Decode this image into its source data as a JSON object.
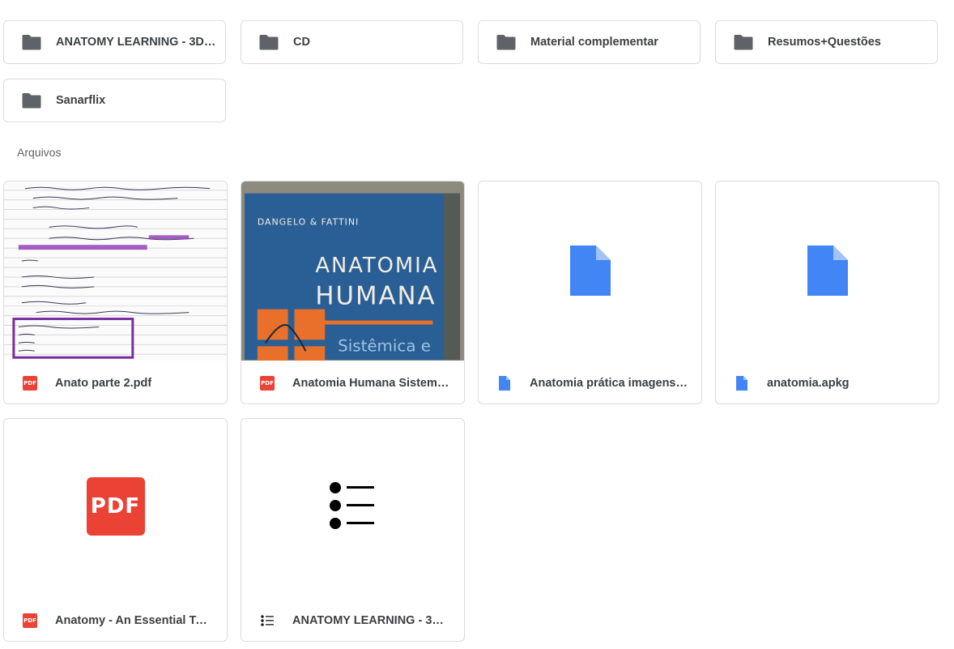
{
  "folders": [
    {
      "name": "ANATOMY LEARNING - 3D A..."
    },
    {
      "name": "CD"
    },
    {
      "name": "Material complementar"
    },
    {
      "name": "Resumos+Questões"
    },
    {
      "name": "Sanarflix"
    }
  ],
  "files_section": {
    "label": "Arquivos"
  },
  "files": [
    {
      "name": "Anato parte 2.pdf",
      "type_icon": "pdf-icon"
    },
    {
      "name": "Anatomia Humana Sistemic...",
      "type_icon": "pdf-icon"
    },
    {
      "name": "Anatomia prática imagens.a...",
      "type_icon": "file-icon"
    },
    {
      "name": "anatomia.apkg",
      "type_icon": "file-icon"
    },
    {
      "name": "Anatomy - An Essential Text...",
      "type_icon": "pdf-icon"
    },
    {
      "name": "ANATOMY LEARNING - 3D A...",
      "type_icon": "list-icon"
    }
  ],
  "thumbnails": {
    "book_cover": {
      "author": "DANGELO & FATTINI",
      "title_line1": "ANATOMIA",
      "title_line2": "HUMANA",
      "subtitle": "Sistêmica e"
    },
    "pdf_badge_small": "PDF",
    "pdf_badge_large": "PDF",
    "notes": {
      "line1": "Sistema Respiratório",
      "line2": "Divisão:",
      "line3": "→ Porção de condução",
      "line4": "→ Porção de respiração",
      "line5": "Porção de Condução"
    }
  },
  "colors": {
    "border": "#dadce0",
    "folder_icon": "#5f6368",
    "pdf_red": "#ea4335",
    "doc_blue": "#4285f4",
    "text": "#3c4043",
    "book_blue": "#2a5f95",
    "book_orange": "#e8702a"
  }
}
